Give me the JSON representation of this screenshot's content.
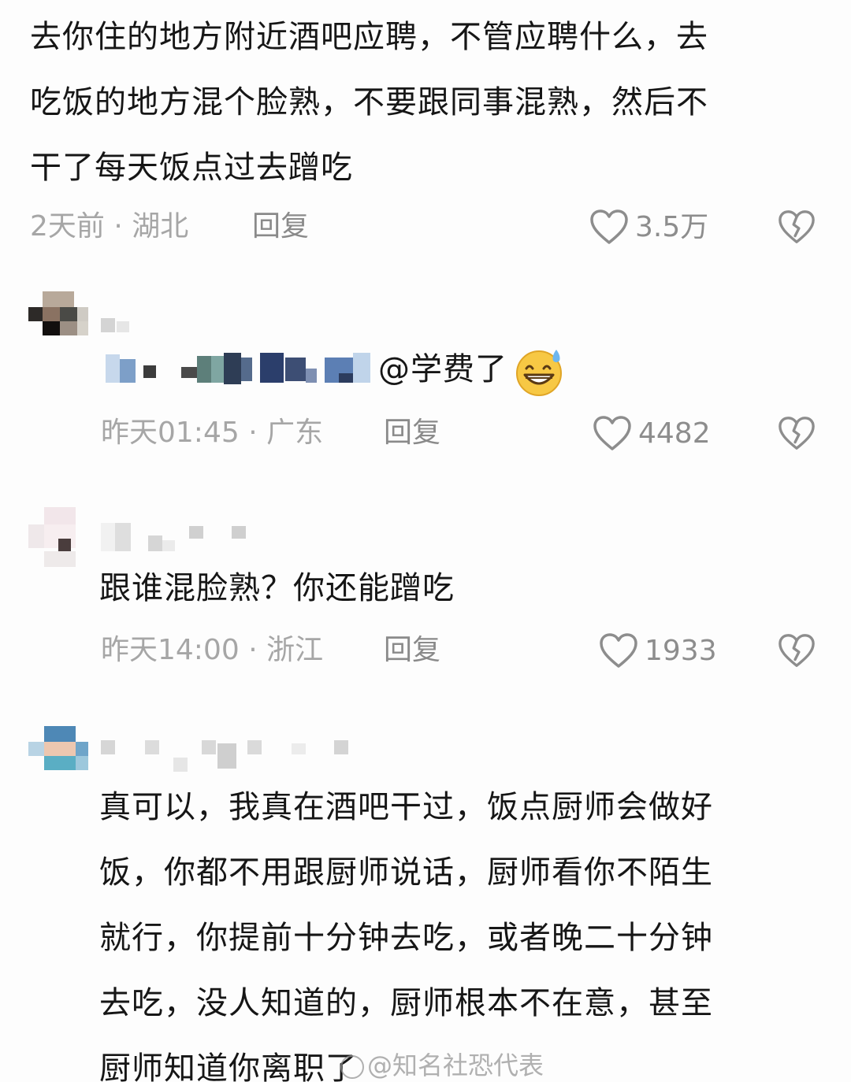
{
  "comments": [
    {
      "lines": [
        "去你住的地方附近酒吧应聘，不管应聘什么，去",
        "吃饭的地方混个脸熟，不要跟同事混熟，然后不",
        "干了每天饭点过去蹭吃"
      ],
      "meta": "2天前 · 湖北",
      "reply_label": "回复",
      "likes": "3.5万"
    },
    {
      "mention": "@学费了",
      "meta": "昨天01:45 · 广东",
      "reply_label": "回复",
      "likes": "4482"
    },
    {
      "lines": [
        "跟谁混脸熟？你还能蹭吃"
      ],
      "meta": "昨天14:00 · 浙江",
      "reply_label": "回复",
      "likes": "1933"
    },
    {
      "lines": [
        "真可以，我真在酒吧干过，饭点厨师会做好",
        "饭，你都不用跟厨师说话，厨师看你不陌生",
        "就行，你提前十分钟去吃，或者晚二十分钟",
        "去吃，没人知道的，厨师根本不在意，甚至",
        "厨师知道你离职了"
      ]
    }
  ],
  "watermark": "@知名社恐代表",
  "icons": {
    "like": "heart-outline-icon",
    "dislike": "broken-heart-icon",
    "emoji": "grinning-sweat-emoji-icon"
  },
  "colors": {
    "text": "#161616",
    "meta": "#a6a6a6",
    "icon": "#8d8d8d"
  }
}
